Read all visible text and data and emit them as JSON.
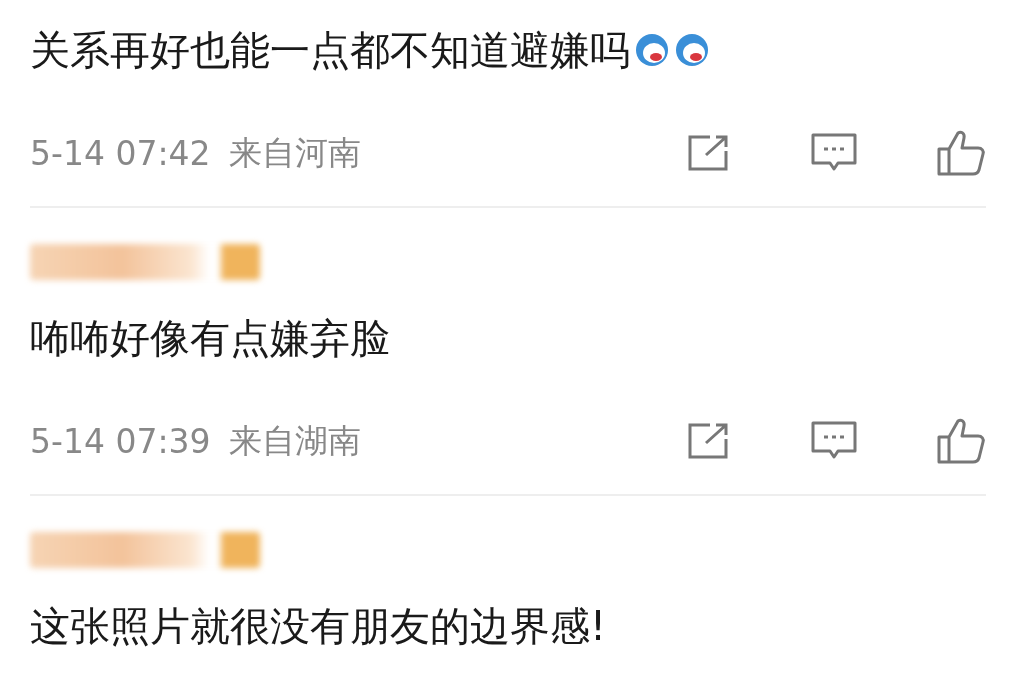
{
  "comments": [
    {
      "author_hidden": false,
      "text": "关系再好也能一点都不知道避嫌吗",
      "emojis": [
        {
          "kind": "face"
        },
        {
          "kind": "face"
        }
      ],
      "meta": {
        "time": "5-14 07:42",
        "location": "来自河南"
      }
    },
    {
      "author_hidden": true,
      "text": "咘咘好像有点嫌弃脸",
      "meta": {
        "time": "5-14 07:39",
        "location": "来自湖南"
      }
    },
    {
      "author_hidden": true,
      "text": "这张照片就很没有朋友的边界感!"
    }
  ]
}
